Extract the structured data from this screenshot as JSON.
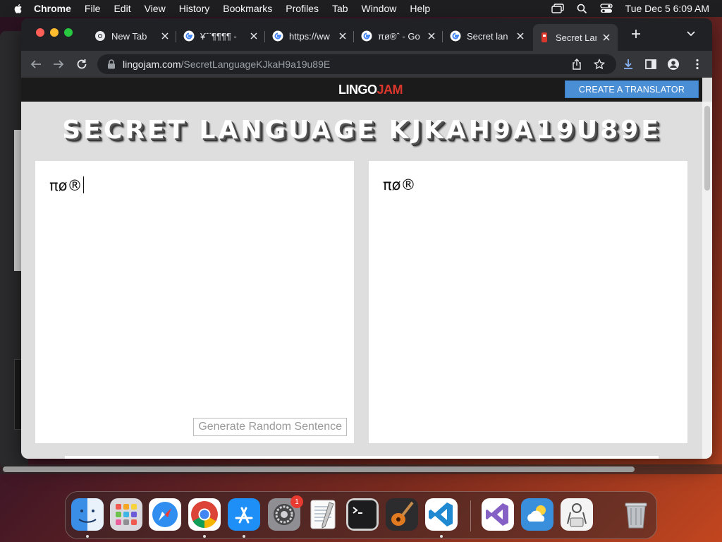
{
  "menubar": {
    "app_name": "Chrome",
    "items": [
      "File",
      "Edit",
      "View",
      "History",
      "Bookmarks",
      "Profiles",
      "Tab",
      "Window",
      "Help"
    ],
    "clock": "Tue Dec 5  6:09 AM"
  },
  "tabs": [
    {
      "title": "New Tab",
      "icon": "chrome-icon"
    },
    {
      "title": "¥¨¨¶¶¶¶ -",
      "icon": "google-icon"
    },
    {
      "title": "https://ww",
      "icon": "google-icon"
    },
    {
      "title": "πø®ˆ - Go",
      "icon": "google-icon"
    },
    {
      "title": "Secret lan",
      "icon": "google-icon"
    },
    {
      "title": "Secret Lan",
      "icon": "lingojam-icon",
      "active": true
    }
  ],
  "address": {
    "host": "lingojam.com",
    "path": "/SecretLanguageKJkaH9a19u89E"
  },
  "site": {
    "logo_lingo": "LINGO",
    "logo_jam": "JAM",
    "create_button": "CREATE A TRANSLATOR",
    "heading": "SECRET LANGUAGE KJKAH9A19U89E",
    "input_text": "πø®",
    "output_text": "πø®",
    "random_button": "Generate Random Sentence"
  },
  "dock": {
    "apps": [
      "Finder",
      "Launchpad",
      "Safari",
      "Google Chrome",
      "App Store",
      "System Settings",
      "TextEdit",
      "Terminal",
      "GarageBand",
      "Visual Studio Code",
      "Visual Studio",
      "Weather",
      "Preview",
      "Trash"
    ],
    "settings_badge": "1"
  },
  "colors": {
    "accent_blue": "#4a8fd6",
    "lingo_red": "#d9362c",
    "tab_bg": "#202124",
    "toolbar_bg": "#35363a"
  }
}
